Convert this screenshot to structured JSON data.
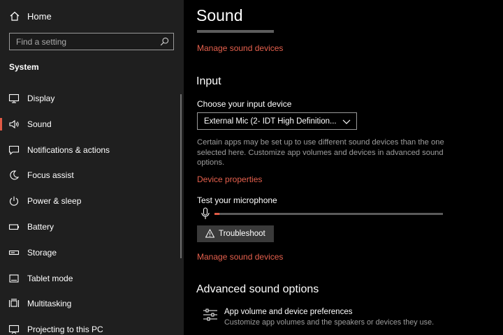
{
  "sidebar": {
    "home_label": "Home",
    "search_placeholder": "Find a setting",
    "section_title": "System",
    "items": [
      {
        "label": "Display",
        "icon": "monitor-icon"
      },
      {
        "label": "Sound",
        "icon": "speaker-icon",
        "selected": true
      },
      {
        "label": "Notifications & actions",
        "icon": "notification-icon"
      },
      {
        "label": "Focus assist",
        "icon": "moon-icon"
      },
      {
        "label": "Power & sleep",
        "icon": "power-icon"
      },
      {
        "label": "Battery",
        "icon": "battery-icon"
      },
      {
        "label": "Storage",
        "icon": "storage-icon"
      },
      {
        "label": "Tablet mode",
        "icon": "tablet-icon"
      },
      {
        "label": "Multitasking",
        "icon": "multitasking-icon"
      },
      {
        "label": "Projecting to this PC",
        "icon": "projecting-icon"
      }
    ]
  },
  "main": {
    "title": "Sound",
    "manage_link_top": "Manage sound devices",
    "input_heading": "Input",
    "choose_label": "Choose your input device",
    "input_device": "External Mic (2- IDT High Definition...",
    "description": "Certain apps may be set up to use different sound devices than the one selected here. Customize app volumes and devices in advanced sound options.",
    "device_properties_link": "Device properties",
    "test_label": "Test your microphone",
    "mic_level": 0.02,
    "troubleshoot_label": "Troubleshoot",
    "manage_link_bottom": "Manage sound devices",
    "advanced_heading": "Advanced sound options",
    "app_volume_title": "App volume and device preferences",
    "app_volume_desc": "Customize app volumes and the speakers or devices they use."
  },
  "colors": {
    "accent": "#e05a45",
    "link": "#e5604d",
    "sidebar_bg": "#1f1f1f",
    "main_bg": "#000000"
  }
}
